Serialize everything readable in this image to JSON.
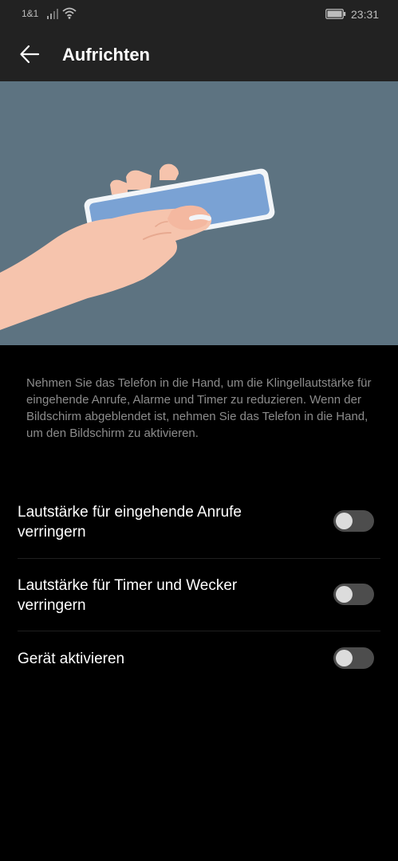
{
  "status_bar": {
    "carrier": "1&1",
    "time": "23:31",
    "icons": [
      "signal-icon",
      "wifi-icon",
      "battery-icon"
    ]
  },
  "app_bar": {
    "title": "Aufrichten",
    "back_icon": "arrow-left-icon"
  },
  "illustration": {
    "subject": "hand-lifting-phone-illustration",
    "colors": {
      "background": "#5d7381",
      "phone_screen": "#7aa2d4",
      "phone_frame": "#f2f5f8",
      "skin": "#f6c4ad"
    }
  },
  "description": "Nehmen Sie das Telefon in die Hand, um die Klingellautstärke für eingehende Anrufe, Alarme und Timer zu reduzieren. Wenn der Bildschirm abgeblendet ist, nehmen Sie das Telefon in die Hand, um den Bildschirm zu aktivieren.",
  "settings": [
    {
      "label": "Lautstärke für eingehende Anrufe verringern",
      "enabled": false
    },
    {
      "label": "Lautstärke für Timer und Wecker verringern",
      "enabled": false
    },
    {
      "label": "Gerät aktivieren",
      "enabled": false
    }
  ],
  "colors": {
    "background": "#000000",
    "bar_background": "#222222",
    "description_text": "#8c8c8c",
    "toggle_off_track": "#4d4d4d",
    "toggle_knob": "#dcdcdc"
  }
}
